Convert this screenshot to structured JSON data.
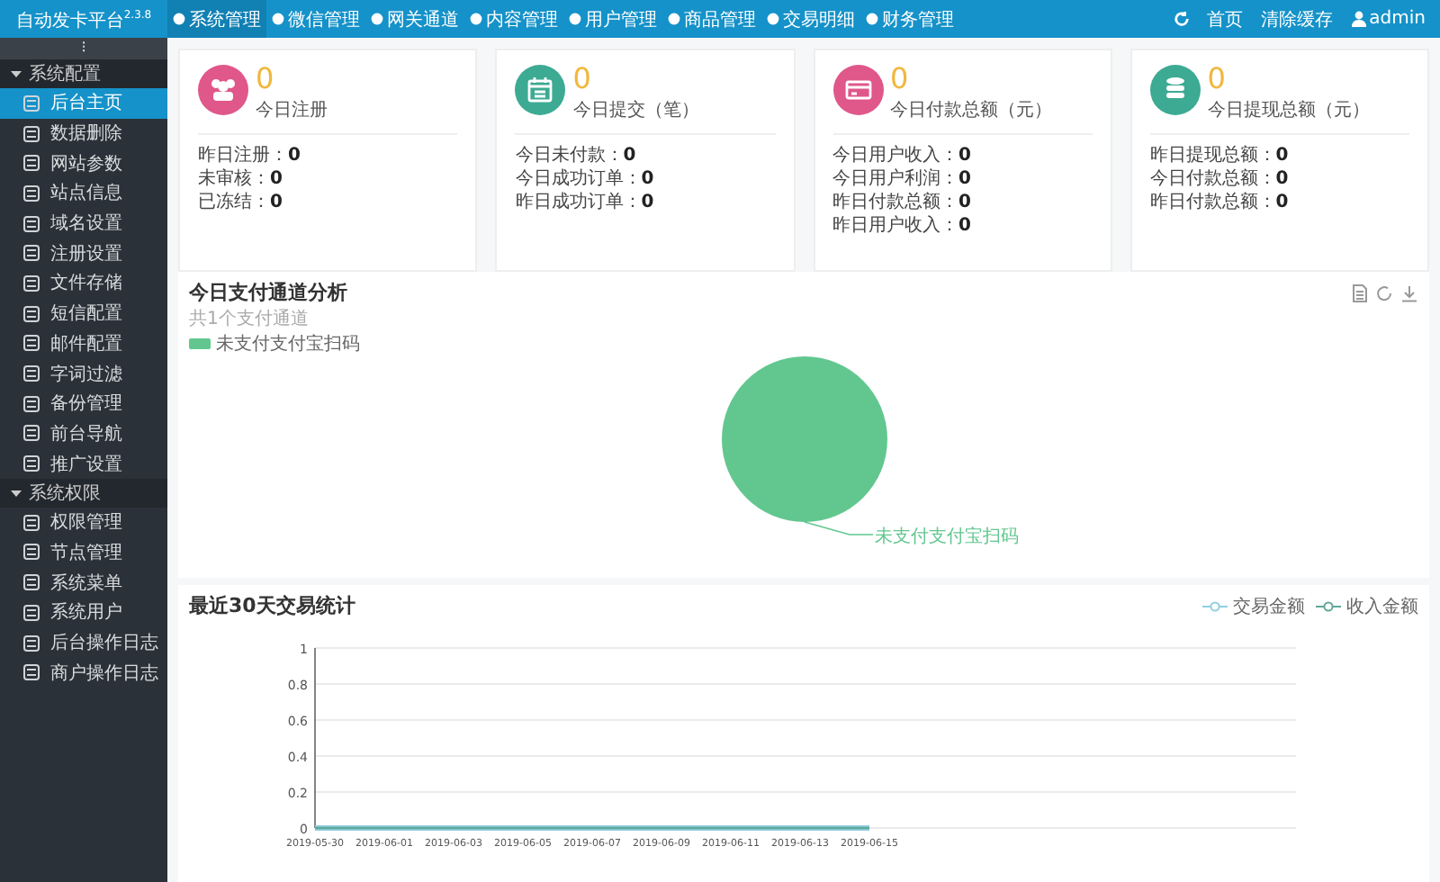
{
  "header": {
    "logo": "自动发卡平台$^{2.3.8}$",
    "nav": [
      {
        "label": "系统管理",
        "selected": true
      },
      {
        "label": "微信管理",
        "selected": false
      },
      {
        "label": "网关通道",
        "selected": false
      },
      {
        "label": "内容管理",
        "selected": false
      },
      {
        "label": "用户管理",
        "selected": false
      },
      {
        "label": "商品管理",
        "selected": false
      },
      {
        "label": "交易明细",
        "selected": false
      },
      {
        "label": "财务管理",
        "selected": false
      }
    ],
    "right_links": [
      "首页",
      "清除缓存"
    ],
    "user": "admin"
  },
  "sidebar": {
    "toggle": "⁝",
    "groups": [
      {
        "title": "系统配置",
        "expanded": true,
        "items": [
          {
            "label": "后台主页",
            "selected": true
          },
          {
            "label": "数据删除",
            "selected": false
          },
          {
            "label": "网站参数",
            "selected": false
          },
          {
            "label": "站点信息",
            "selected": false
          },
          {
            "label": "域名设置",
            "selected": false
          },
          {
            "label": "注册设置",
            "selected": false
          },
          {
            "label": "文件存储",
            "selected": false
          },
          {
            "label": "短信配置",
            "selected": false
          },
          {
            "label": "邮件配置",
            "selected": false
          },
          {
            "label": "字词过滤",
            "selected": false
          },
          {
            "label": "备份管理",
            "selected": false
          },
          {
            "label": "前台导航",
            "selected": false
          },
          {
            "label": "推广设置",
            "selected": false
          }
        ]
      },
      {
        "title": "系统权限",
        "expanded": true,
        "items": [
          {
            "label": "权限管理",
            "selected": false
          },
          {
            "label": "节点管理",
            "selected": false
          },
          {
            "label": "系统菜单",
            "selected": false
          },
          {
            "label": "系统用户",
            "selected": false
          },
          {
            "label": "后台操作日志",
            "selected": false
          },
          {
            "label": "商户操作日志",
            "selected": false
          }
        ]
      }
    ]
  },
  "stat_cards": [
    {
      "value": "0",
      "label": "今日注册",
      "color": "#e0578a",
      "kind": "users",
      "lines": [
        {
          "label": "昨日注册：",
          "value": "0"
        },
        {
          "label": "未审核：",
          "value": "0"
        },
        {
          "label": "已冻结：",
          "value": "0"
        }
      ]
    },
    {
      "value": "0",
      "label": "今日提交（笔）",
      "color": "#3daa93",
      "kind": "calendar",
      "lines": [
        {
          "label": "今日未付款：",
          "value": "0"
        },
        {
          "label": "今日成功订单：",
          "value": "0"
        },
        {
          "label": "昨日成功订单：",
          "value": "0"
        }
      ]
    },
    {
      "value": "0",
      "label": "今日付款总额（元）",
      "color": "#e0578a",
      "kind": "card",
      "lines": [
        {
          "label": "今日用户收入：",
          "value": "0"
        },
        {
          "label": "今日用户利润：",
          "value": "0"
        },
        {
          "label": "昨日付款总额：",
          "value": "0"
        },
        {
          "label": "昨日用户收入：",
          "value": "0"
        }
      ]
    },
    {
      "value": "0",
      "label": "今日提现总额（元）",
      "color": "#3daa93",
      "kind": "database",
      "lines": [
        {
          "label": "昨日提现总额：",
          "value": "0"
        },
        {
          "label": "今日付款总额：",
          "value": "0"
        },
        {
          "label": "昨日付款总额：",
          "value": "0"
        }
      ]
    }
  ],
  "pie_panel": {
    "title": "今日支付通道分析",
    "subtitle": "共1个支付通道",
    "legend": [
      {
        "label": "未支付支付宝扫码",
        "color": "#62c78f"
      }
    ],
    "slice_label": "未支付支付宝扫码"
  },
  "line_panel": {
    "title": "最近30天交易统计",
    "chart_data": {
      "type": "line",
      "x": [
        "2019-05-30",
        "2019-06-01",
        "2019-06-03",
        "2019-06-05",
        "2019-06-07",
        "2019-06-09",
        "2019-06-11",
        "2019-06-13",
        "2019-06-15"
      ],
      "series": [
        {
          "name": "交易金额",
          "color": "#8fd0e0",
          "values": [
            0,
            0,
            0,
            0,
            0,
            0,
            0,
            0,
            0
          ]
        },
        {
          "name": "收入金额",
          "color": "#5fa89a",
          "values": [
            0,
            0,
            0,
            0,
            0,
            0,
            0,
            0,
            0
          ]
        }
      ],
      "ylim": [
        0,
        1
      ],
      "yticks": [
        0,
        0.2,
        0.4,
        0.6,
        0.8,
        1
      ],
      "grid": true
    }
  }
}
